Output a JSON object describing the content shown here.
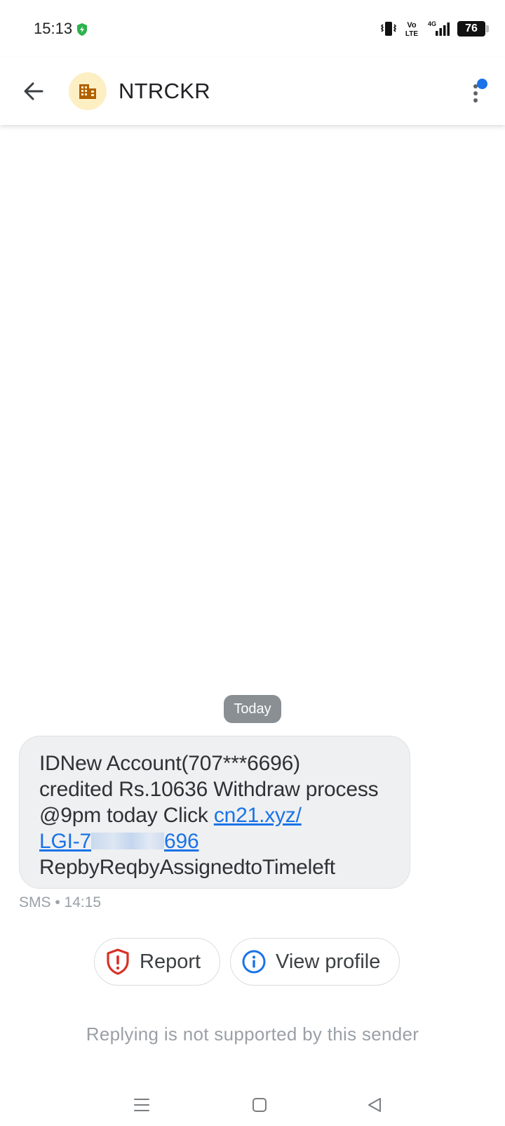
{
  "status_bar": {
    "time": "15:13",
    "battery": "76",
    "icons": [
      "shield-icon",
      "vibrate-icon",
      "volte-icon",
      "4g-signal-icon",
      "battery-icon"
    ]
  },
  "header": {
    "sender_name": "NTRCKR",
    "avatar_icon": "building-icon",
    "back_icon": "arrow-left-icon",
    "more_icon": "more-vert-icon"
  },
  "conversation": {
    "date_chip": "Today",
    "message": {
      "line1": "IDNew Account(707***6696)",
      "line2": "credited Rs.10636 Withdraw process",
      "line3_text": "@9pm today Click ",
      "link_part1": "cn21.xyz/",
      "link_part2_start": "LGI-7",
      "link_part2_end": "696",
      "line5": "RepbyReqbyAssignedtoTimeleft"
    },
    "meta": "SMS • 14:15"
  },
  "actions": {
    "report_label": "Report",
    "view_profile_label": "View profile"
  },
  "reply_note": "Replying is not supported by this sender",
  "colors": {
    "accent": "#1a73e8",
    "report_red": "#d93025",
    "avatar_bg": "#fdefc4",
    "avatar_icon": "#b06000",
    "bubble_bg": "#eff0f1",
    "date_chip_bg": "#8a8f94"
  },
  "nav": {
    "icons": [
      "recents-icon",
      "home-icon",
      "back-triangle-icon"
    ]
  }
}
